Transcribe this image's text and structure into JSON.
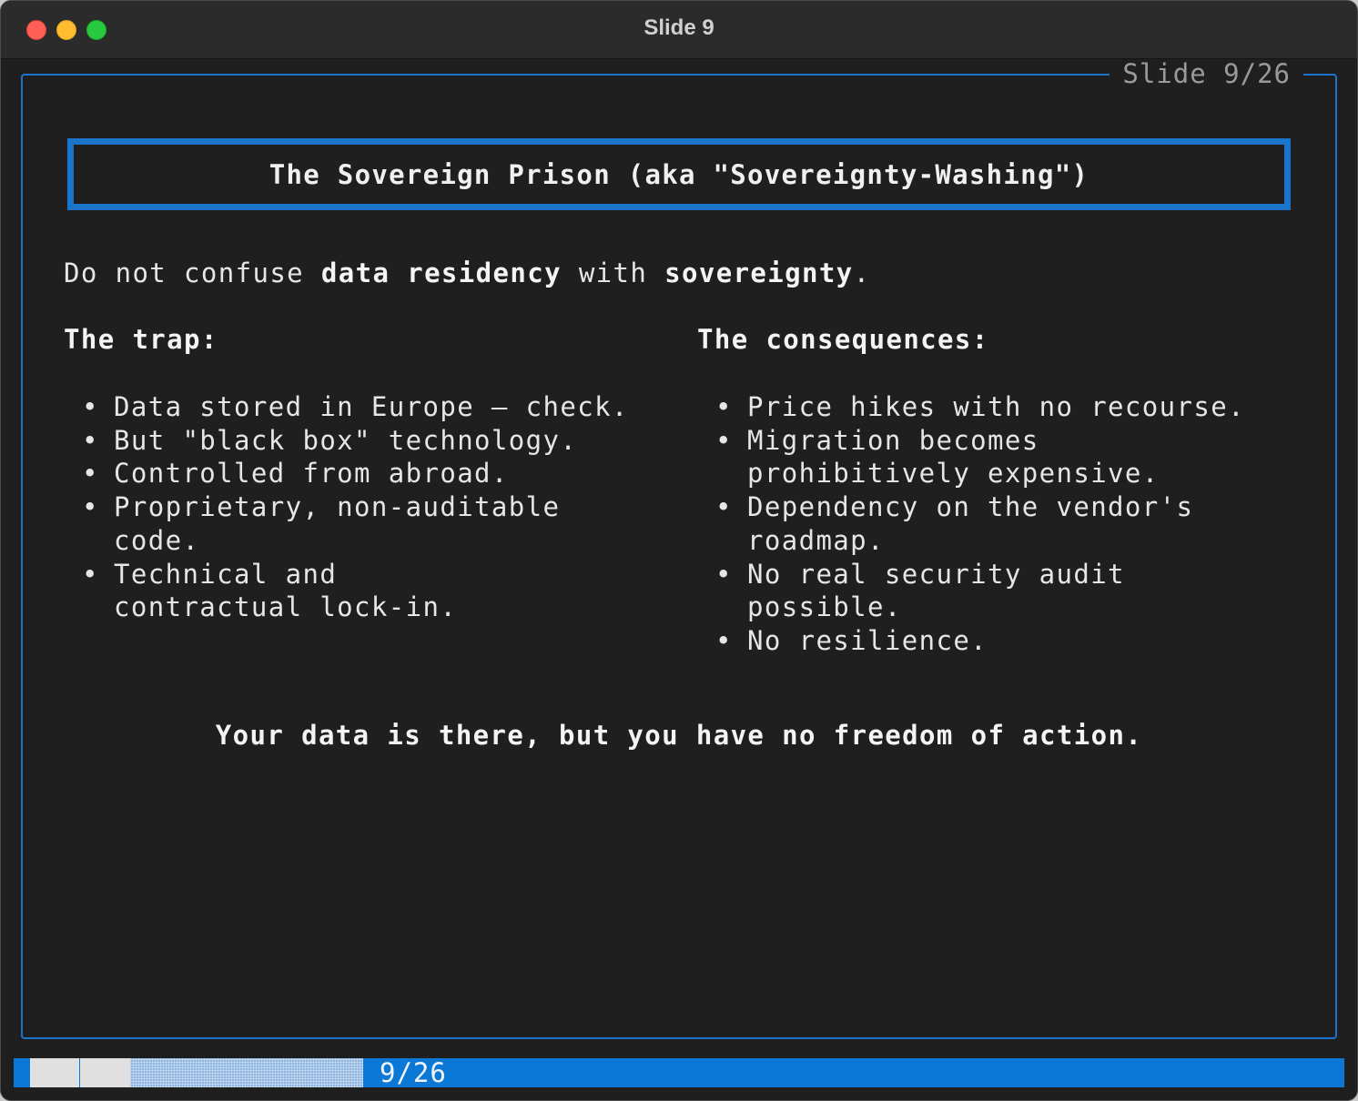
{
  "window": {
    "title": "Slide 9"
  },
  "slide": {
    "counter": "Slide 9/26",
    "title": "The Sovereign Prison (aka \"Sovereignty-Washing\")",
    "intro": {
      "part1": "Do not confuse ",
      "bold1": "data residency",
      "part2": " with ",
      "bold2": "sovereignty",
      "part3": "."
    },
    "trap": {
      "heading": "The trap:",
      "items": [
        "Data stored in Europe — check.",
        "But \"black box\" technology.",
        "Controlled from abroad.",
        "Proprietary, non-auditable code.",
        "Technical and contractual lock-in."
      ]
    },
    "consequences": {
      "heading": "The consequences:",
      "items": [
        "Price hikes with no recourse.",
        "Migration becomes prohibitively expensive.",
        "Dependency on the vendor's roadmap.",
        "No real security audit possible.",
        "No resilience."
      ]
    },
    "tagline": "Your data is there, but you have no freedom of action."
  },
  "statusbar": {
    "progress_label": "9/26",
    "progress_fraction": 0.346
  },
  "colors": {
    "accent": "#1a74c9",
    "statusbar": "#0a78d4",
    "background": "#1f1f1f"
  }
}
